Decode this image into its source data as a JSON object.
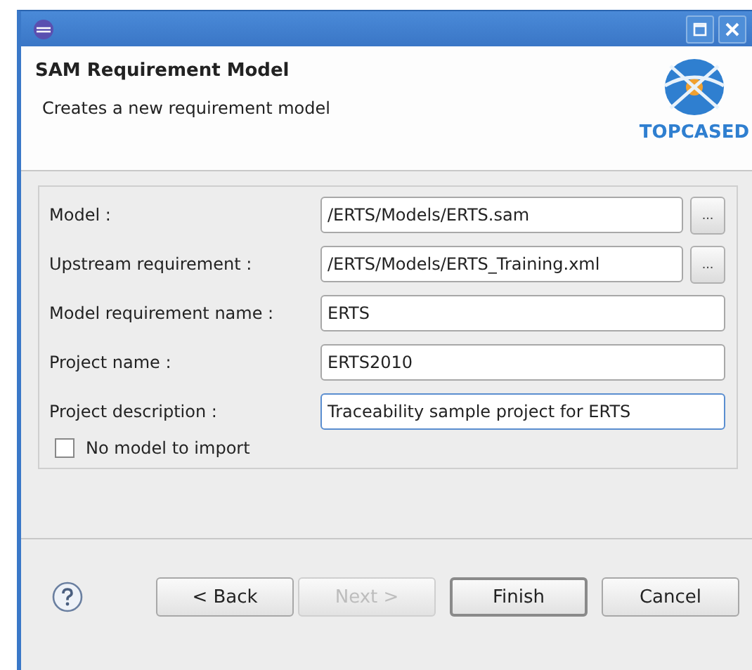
{
  "window": {
    "buttons": [
      {
        "kind": "maximize"
      },
      {
        "kind": "close"
      }
    ]
  },
  "header": {
    "title": "SAM Requirement Model",
    "description": "Creates a new requirement model",
    "logo_text": "TOPCASED"
  },
  "fields": [
    {
      "label": "Model :",
      "value": "/ERTS/Models/ERTS.sam",
      "browse": "...",
      "focused": false
    },
    {
      "label": "Upstream requirement :",
      "value": "/ERTS/Models/ERTS_Training.xml",
      "browse": "...",
      "focused": false
    },
    {
      "label": "Model requirement name :",
      "value": "ERTS",
      "focused": false
    },
    {
      "label": "Project name :",
      "value": "ERTS2010",
      "focused": false
    },
    {
      "label": "Project description :",
      "value": "Traceability sample project for ERTS",
      "focused": true
    }
  ],
  "checkbox": {
    "label": "No model to import",
    "checked": false
  },
  "buttons": [
    {
      "label": "< Back",
      "disabled": false,
      "default": false
    },
    {
      "label": "Next >",
      "disabled": true,
      "default": false
    },
    {
      "label": "Finish",
      "disabled": false,
      "default": true
    },
    {
      "label": "Cancel",
      "disabled": false,
      "default": false
    }
  ]
}
